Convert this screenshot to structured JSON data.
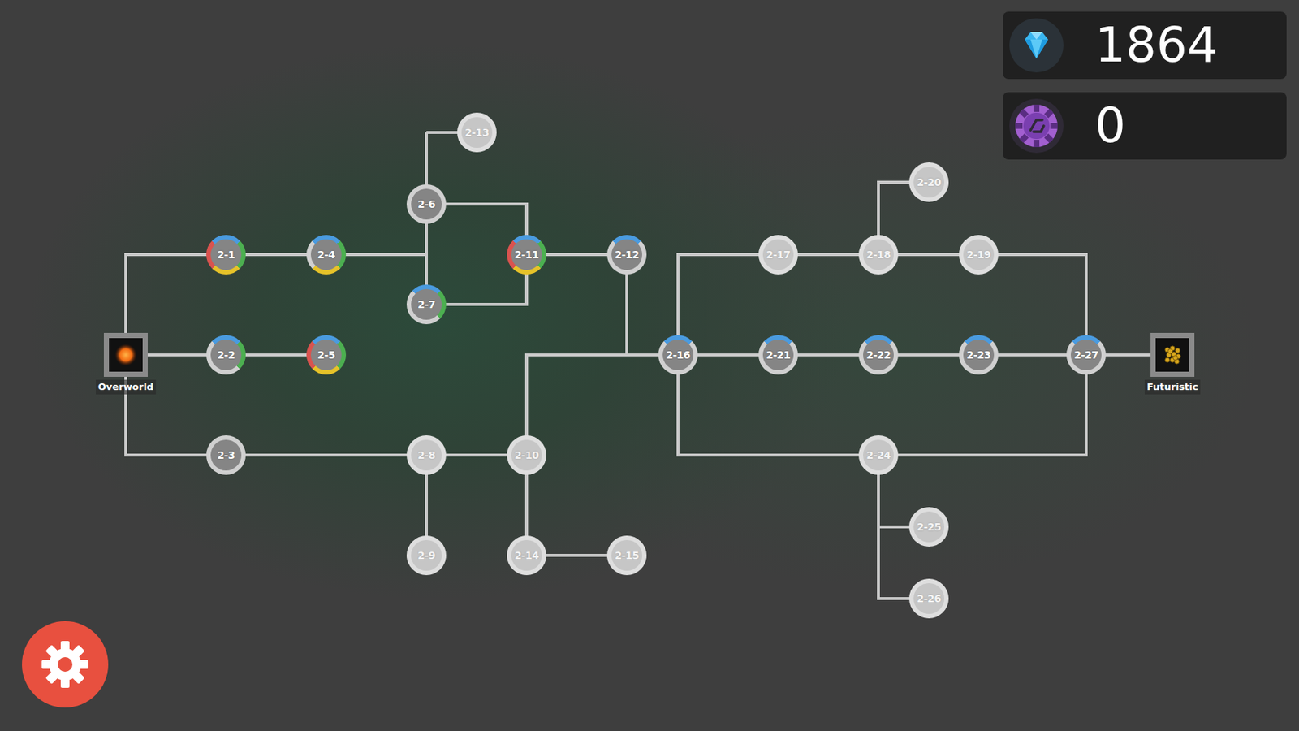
{
  "currencies": [
    {
      "kind": "gem",
      "value": "1864"
    },
    {
      "kind": "chip",
      "value": "0"
    }
  ],
  "worlds": [
    {
      "label": "Overworld",
      "kind": "overworld"
    },
    {
      "label": "Futuristic",
      "kind": "futuristic"
    }
  ],
  "levels": [
    {
      "label": "2-1",
      "unlocked": true,
      "segments": [
        "#4a9be0",
        "#4caf50",
        "#e6c229",
        "#d9534f"
      ]
    },
    {
      "label": "2-2",
      "unlocked": true,
      "segments": [
        "#4a9be0",
        "#4caf50",
        "#d0d0d0",
        "#d0d0d0"
      ]
    },
    {
      "label": "2-3",
      "unlocked": true,
      "segments": [
        "#d0d0d0",
        "#d0d0d0",
        "#d0d0d0",
        "#d0d0d0"
      ]
    },
    {
      "label": "2-4",
      "unlocked": true,
      "segments": [
        "#4a9be0",
        "#4caf50",
        "#e6c229",
        "#d0d0d0"
      ]
    },
    {
      "label": "2-5",
      "unlocked": true,
      "segments": [
        "#4a9be0",
        "#4caf50",
        "#e6c229",
        "#d9534f"
      ]
    },
    {
      "label": "2-6",
      "unlocked": true,
      "segments": [
        "#d0d0d0",
        "#d0d0d0",
        "#d0d0d0",
        "#d0d0d0"
      ]
    },
    {
      "label": "2-7",
      "unlocked": true,
      "segments": [
        "#4a9be0",
        "#4caf50",
        "#d0d0d0",
        "#d0d0d0"
      ]
    },
    {
      "label": "2-8",
      "unlocked": false,
      "segments": [
        "#dedede",
        "#dedede",
        "#dedede",
        "#dedede"
      ]
    },
    {
      "label": "2-9",
      "unlocked": false,
      "segments": [
        "#dedede",
        "#dedede",
        "#dedede",
        "#dedede"
      ]
    },
    {
      "label": "2-10",
      "unlocked": false,
      "segments": [
        "#dedede",
        "#dedede",
        "#dedede",
        "#dedede"
      ]
    },
    {
      "label": "2-11",
      "unlocked": true,
      "segments": [
        "#4a9be0",
        "#4caf50",
        "#e6c229",
        "#d9534f"
      ]
    },
    {
      "label": "2-12",
      "unlocked": true,
      "segments": [
        "#4a9be0",
        "#d0d0d0",
        "#d0d0d0",
        "#d0d0d0"
      ]
    },
    {
      "label": "2-13",
      "unlocked": false,
      "segments": [
        "#dedede",
        "#dedede",
        "#dedede",
        "#dedede"
      ]
    },
    {
      "label": "2-14",
      "unlocked": false,
      "segments": [
        "#dedede",
        "#dedede",
        "#dedede",
        "#dedede"
      ]
    },
    {
      "label": "2-15",
      "unlocked": false,
      "segments": [
        "#dedede",
        "#dedede",
        "#dedede",
        "#dedede"
      ]
    },
    {
      "label": "2-16",
      "unlocked": true,
      "segments": [
        "#4a9be0",
        "#d0d0d0",
        "#d0d0d0",
        "#d0d0d0"
      ]
    },
    {
      "label": "2-17",
      "unlocked": false,
      "segments": [
        "#dedede",
        "#dedede",
        "#dedede",
        "#dedede"
      ]
    },
    {
      "label": "2-18",
      "unlocked": false,
      "segments": [
        "#dedede",
        "#dedede",
        "#dedede",
        "#dedede"
      ]
    },
    {
      "label": "2-19",
      "unlocked": false,
      "segments": [
        "#dedede",
        "#dedede",
        "#dedede",
        "#dedede"
      ]
    },
    {
      "label": "2-20",
      "unlocked": false,
      "segments": [
        "#dedede",
        "#dedede",
        "#dedede",
        "#dedede"
      ]
    },
    {
      "label": "2-21",
      "unlocked": true,
      "segments": [
        "#4a9be0",
        "#d0d0d0",
        "#d0d0d0",
        "#d0d0d0"
      ]
    },
    {
      "label": "2-22",
      "unlocked": true,
      "segments": [
        "#4a9be0",
        "#d0d0d0",
        "#d0d0d0",
        "#d0d0d0"
      ]
    },
    {
      "label": "2-23",
      "unlocked": true,
      "segments": [
        "#4a9be0",
        "#d0d0d0",
        "#d0d0d0",
        "#d0d0d0"
      ]
    },
    {
      "label": "2-24",
      "unlocked": false,
      "segments": [
        "#dedede",
        "#dedede",
        "#dedede",
        "#dedede"
      ]
    },
    {
      "label": "2-25",
      "unlocked": false,
      "segments": [
        "#dedede",
        "#dedede",
        "#dedede",
        "#dedede"
      ]
    },
    {
      "label": "2-26",
      "unlocked": false,
      "segments": [
        "#dedede",
        "#dedede",
        "#dedede",
        "#dedede"
      ]
    },
    {
      "label": "2-27",
      "unlocked": true,
      "segments": [
        "#4a9be0",
        "#d0d0d0",
        "#d0d0d0",
        "#d0d0d0"
      ]
    }
  ]
}
